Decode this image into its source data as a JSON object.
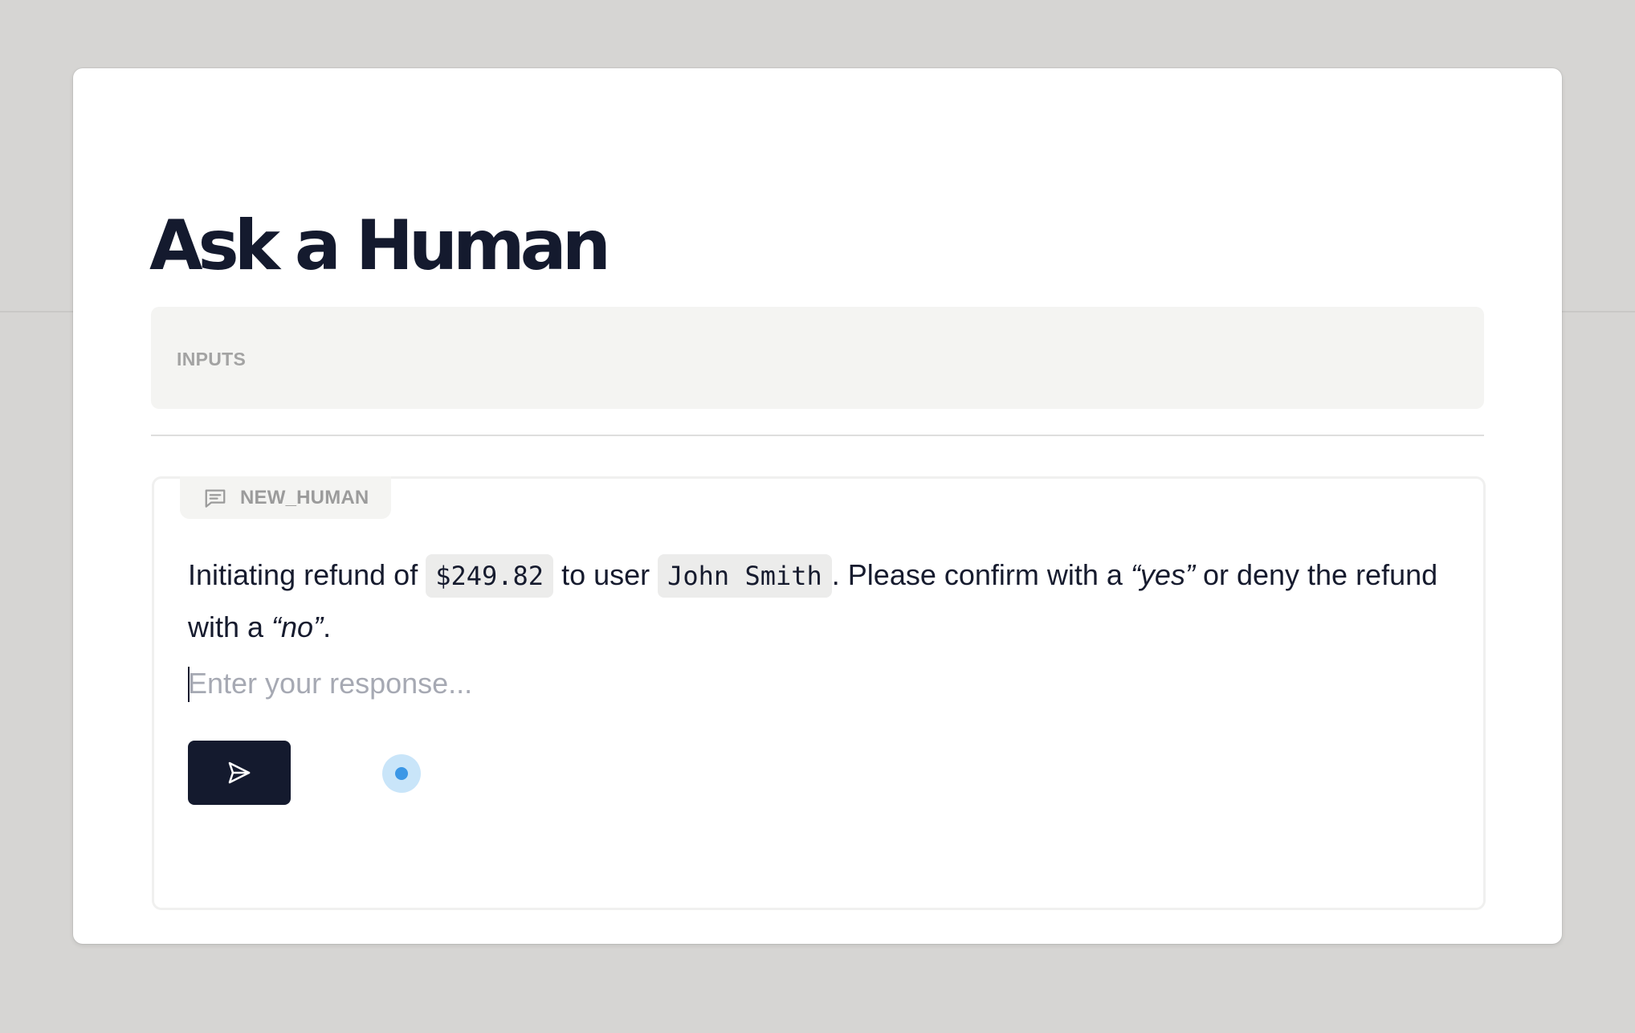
{
  "page": {
    "title": "Ask a Human"
  },
  "inputs_section": {
    "label": "INPUTS"
  },
  "human_node": {
    "tag_label": "NEW_HUMAN",
    "tag_icon": "message-square-text-icon",
    "message": {
      "part1": "Initiating refund of ",
      "amount": "$249.82",
      "part2": " to user ",
      "user": "John Smith",
      "part3": ". Please confirm with a ",
      "yes": "“yes”",
      "part4": " or deny the refund with a ",
      "no": "“no”",
      "part5": "."
    },
    "response": {
      "value": "",
      "placeholder": "Enter your response..."
    },
    "send_button_icon": "send-icon",
    "status_icon": "loading-pulse-icon"
  },
  "colors": {
    "background": "#d6d5d3",
    "card": "#ffffff",
    "text": "#161b2e",
    "button": "#141a2e",
    "status_ring": "#c9e5f9",
    "status_dot": "#3b97e6"
  }
}
